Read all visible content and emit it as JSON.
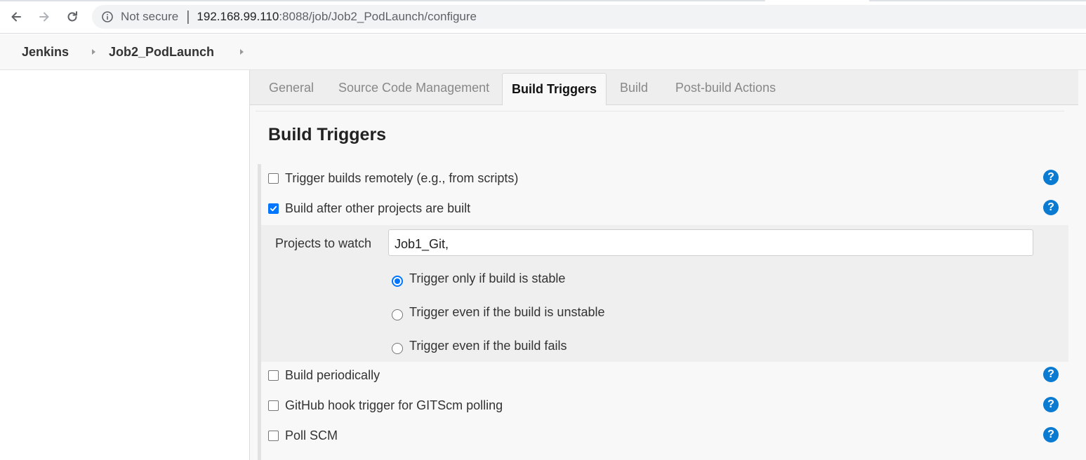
{
  "browser": {
    "security_label": "Not secure",
    "separator": "|",
    "url_host": "192.168.99.110",
    "url_path": ":8088/job/Job2_PodLaunch/configure"
  },
  "breadcrumb": {
    "items": [
      "Jenkins",
      "Job2_PodLaunch"
    ]
  },
  "tabs": [
    {
      "label": "General",
      "active": false
    },
    {
      "label": "Source Code Management",
      "active": false
    },
    {
      "label": "Build Triggers",
      "active": true
    },
    {
      "label": "Build",
      "active": false
    },
    {
      "label": "Post-build Actions",
      "active": false
    }
  ],
  "section": {
    "title": "Build Triggers",
    "help_glyph": "?"
  },
  "triggers": [
    {
      "label": "Trigger builds remotely (e.g., from scripts)",
      "checked": false
    },
    {
      "label": "Build after other projects are built",
      "checked": true
    },
    {
      "label": "Build periodically",
      "checked": false
    },
    {
      "label": "GitHub hook trigger for GITScm polling",
      "checked": false
    },
    {
      "label": "Poll SCM",
      "checked": false
    }
  ],
  "build_after": {
    "projects_label": "Projects to watch",
    "projects_value": "Job1_Git,",
    "options": [
      {
        "label": "Trigger only if build is stable",
        "selected": true
      },
      {
        "label": "Trigger even if the build is unstable",
        "selected": false
      },
      {
        "label": "Trigger even if the build fails",
        "selected": false
      }
    ]
  },
  "colors": {
    "accent": "#0075ff",
    "help": "#0b7ad1"
  }
}
